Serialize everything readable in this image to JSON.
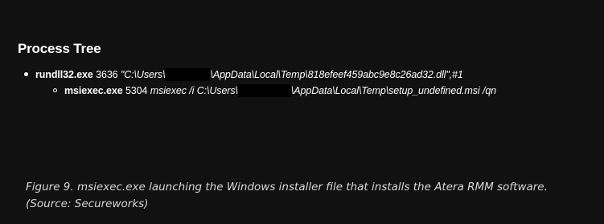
{
  "heading": "Process Tree",
  "tree": {
    "parent": {
      "process": "rundll32.exe",
      "pid": "3636",
      "command_before_redaction": "\"C:\\Users\\",
      "command_after_redaction": "\\AppData\\Local\\Temp\\818efeef459abc9e8c26ad32.dll\",#1"
    },
    "child": {
      "process": "msiexec.exe",
      "pid": "5304",
      "command_before_redaction": "msiexec /i C:\\Users\\",
      "command_after_redaction": "\\AppData\\Local\\Temp\\setup_undefined.msi /qn"
    }
  },
  "caption": "Figure 9. msiexec.exe launching the Windows installer file that installs the Atera RMM software. (Source: Secureworks)"
}
